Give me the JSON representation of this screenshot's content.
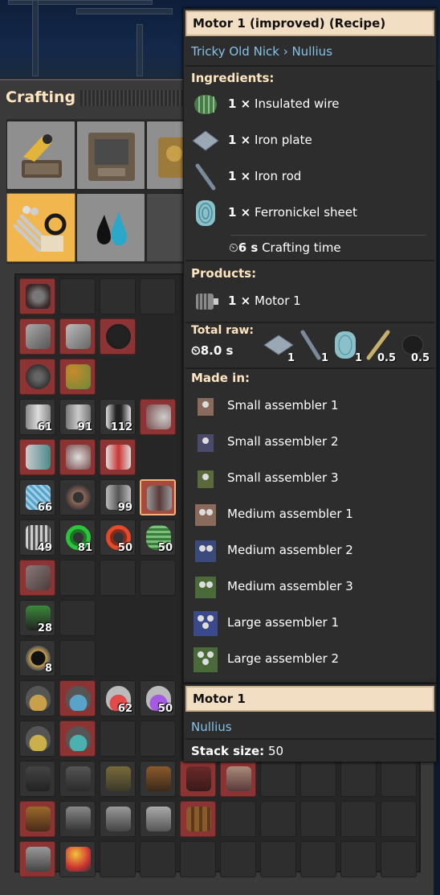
{
  "crafting": {
    "title": "Crafting",
    "groups": [
      "group-logistics",
      "group-production",
      "group-intermediates-2",
      "group-intermediates",
      "group-chemicals"
    ],
    "grid_counts": {
      "barrel_1": "61",
      "barrel_2": "91",
      "coupler": "112",
      "coil_1": "66",
      "motor_housing": "99",
      "transformer": "49",
      "wire_green": "81",
      "wire_red": "50",
      "insulated_wire": "50",
      "circuit": "28",
      "fan": "8",
      "flask_red": "62",
      "flask_purple": "50"
    }
  },
  "recipe_tooltip": {
    "title": "Motor 1 (improved) (Recipe)",
    "mod_path": "Tricky Old Nick › Nullius",
    "ingredients_header": "Ingredients:",
    "ingredients": [
      {
        "amount": "1 ×",
        "name": "Insulated wire",
        "icon": "insulated-wire-icon"
      },
      {
        "amount": "1 ×",
        "name": "Iron plate",
        "icon": "iron-plate-icon"
      },
      {
        "amount": "1 ×",
        "name": "Iron rod",
        "icon": "iron-rod-icon"
      },
      {
        "amount": "1 ×",
        "name": "Ferronickel sheet",
        "icon": "ferronickel-sheet-icon"
      }
    ],
    "crafting_time_value": "6 s",
    "crafting_time_label": "Crafting time",
    "products_header": "Products:",
    "product": {
      "amount": "1 ×",
      "name": "Motor 1",
      "icon": "motor-icon"
    },
    "total_raw_label": "Total raw:",
    "total_raw_time": "8.0 s",
    "total_raw": [
      "1",
      "1",
      "1",
      "0.5",
      "0.5"
    ],
    "made_in_header": "Made in:",
    "made_in": [
      "Small assembler 1",
      "Small assembler 2",
      "Small assembler 3",
      "Medium assembler 1",
      "Medium assembler 2",
      "Medium assembler 3",
      "Large assembler 1",
      "Large assembler 2"
    ]
  },
  "item_tooltip": {
    "title": "Motor 1",
    "mod": "Nullius",
    "stack_label": "Stack size:",
    "stack_value": "50"
  },
  "colors": {
    "title_bar": "#f2dfc3",
    "section_header": "#ffe6c0",
    "link": "#84c3e8",
    "selected_tab": "#f1b64e",
    "unavailable_slot": "#8c3433"
  }
}
